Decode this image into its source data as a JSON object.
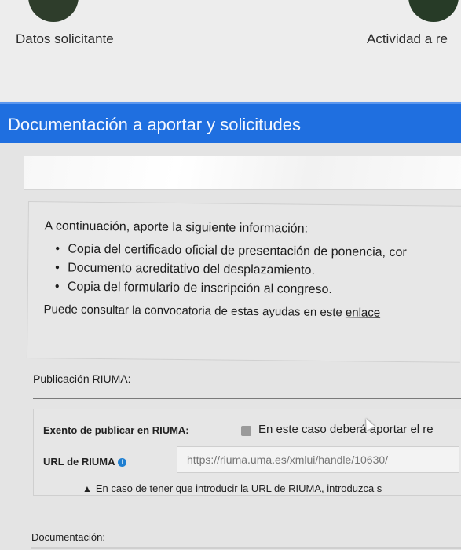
{
  "steps": {
    "step1_label": "Datos solicitante",
    "step2_label": "Actividad a re"
  },
  "section": {
    "title": "Documentación a aportar y solicitudes"
  },
  "info": {
    "intro": "A continuación, aporte la siguiente información:",
    "items": [
      "Copia del certificado oficial de presentación de ponencia, cor",
      "Documento acreditativo del desplazamiento.",
      "Copia del formulario de inscripción al congreso."
    ],
    "consult_text": "Puede consultar la convocatoria de estas ayudas en este",
    "consult_link": "enlace"
  },
  "publicacion": {
    "title": "Publicación RIUMA:",
    "exento_label": "Exento de publicar en RIUMA:",
    "exento_note": "En este caso deberá aportar el re",
    "url_label": "URL de RIUMA",
    "url_value": "https://riuma.uma.es/xmlui/handle/10630/",
    "warning": "En caso de tener que introducir la URL de RIUMA, introduzca s"
  },
  "documentacion": {
    "title": "Documentación:"
  },
  "colors": {
    "header_blue": "#1f6fe0",
    "step_circle": "#2e3d2b",
    "info_icon": "#1f7fd1"
  },
  "icons": {
    "info": "info-circle-icon",
    "warning": "warning-triangle-icon",
    "cursor": "mouse-cursor-icon"
  }
}
